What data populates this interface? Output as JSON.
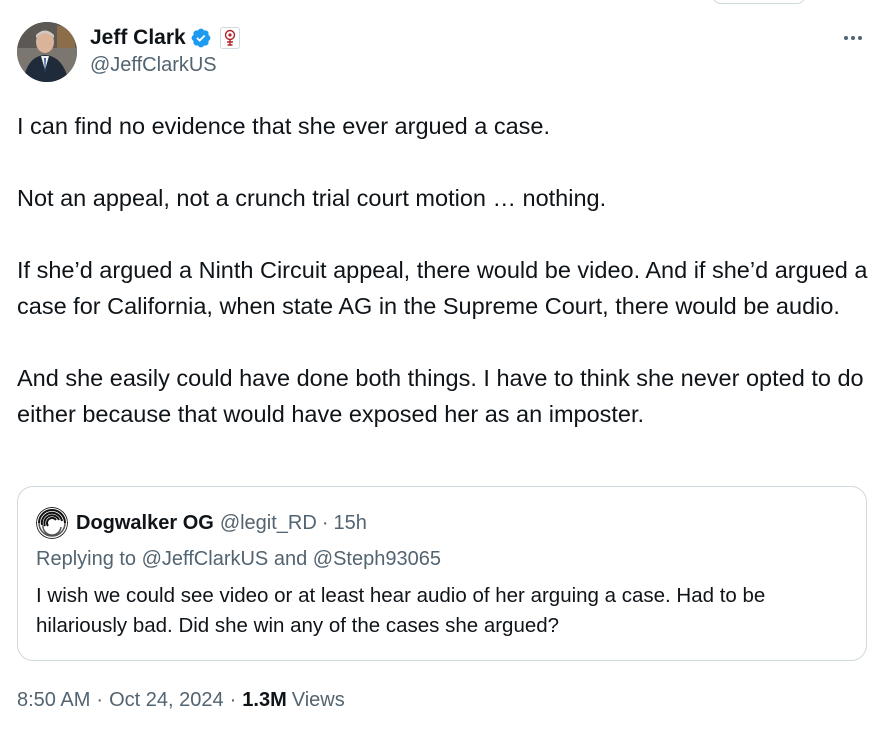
{
  "tweet": {
    "author": {
      "display_name": "Jeff Clark",
      "handle": "@JeffClarkUS",
      "verified_icon": "verified-badge-icon",
      "affiliation_icon": "affiliation-badge-icon"
    },
    "paragraphs": [
      "I can find no evidence that she ever argued a case.",
      "Not an appeal, not a crunch trial court motion … nothing.",
      "If she’d argued a Ninth Circuit appeal, there would be video. And if she’d argued a case for California, when state AG in the Supreme Court, there would be audio.",
      "And she easily could have done both things. I have to think she never opted to do either because that would have exposed her as an imposter."
    ],
    "quoted": {
      "display_name": "Dogwalker OG",
      "handle": "@legit_RD",
      "separator": "·",
      "time": "15h",
      "reply_prefix": "Replying to",
      "reply_user_1": "@JeffClarkUS",
      "reply_and": "and",
      "reply_user_2": "@Steph93065",
      "text": "I wish we could see video or at least hear audio of her arguing a case. Had to be hilariously bad. Did she win any of the cases she argued?"
    },
    "meta": {
      "time": "8:50 AM",
      "separator": "·",
      "date": "Oct 24, 2024",
      "views_count": "1.3M",
      "views_label": "Views"
    }
  },
  "colors": {
    "text_primary": "#0f1419",
    "text_secondary": "#536471",
    "verified_blue": "#1d9bf0",
    "border": "#cfd9de"
  }
}
